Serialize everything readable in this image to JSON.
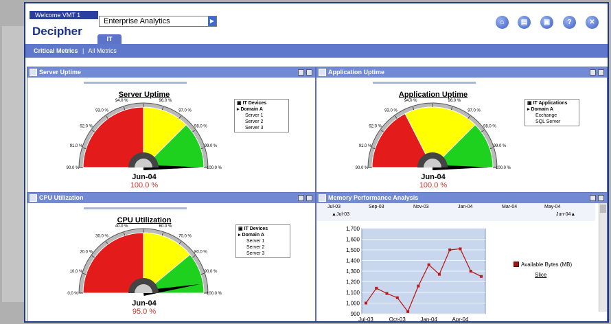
{
  "header": {
    "welcome": "Welcome VMT 1",
    "brand": "Decipher",
    "selector_value": "Enterprise Analytics",
    "tab_label": "IT"
  },
  "toolbar": {
    "icons": [
      "home-icon",
      "reports-icon",
      "print-icon",
      "help-icon",
      "close-icon"
    ],
    "help_glyph": "?",
    "close_glyph": "✕"
  },
  "nav": {
    "critical": "Critical Metrics",
    "separator": "|",
    "all": "All Metrics"
  },
  "panels": {
    "server": {
      "header": "Server Uptime",
      "title": "Server Uptime",
      "date": "Jun-04",
      "value": "100.0 %",
      "value_pct": 100,
      "labels": [
        "90.0 %",
        "91.0 %",
        "92.0 %",
        "93.0 %",
        "94.0 %",
        "95.0 %",
        "96.0 %",
        "97.0 %",
        "98.0 %",
        "99.0 %",
        "100.0 %"
      ],
      "tree": {
        "head": "IT Devices",
        "selected": "Domain A",
        "items": [
          "Server 1",
          "Server 2",
          "Server 3"
        ]
      }
    },
    "app": {
      "header": "Application Uptime",
      "title": "Application Uptime",
      "date": "Jun-04",
      "value": "100.0 %",
      "value_pct": 100,
      "labels": [
        "90.0 %",
        "91.0 %",
        "92.0 %",
        "93.0 %",
        "94.0 %",
        "95.0 %",
        "96.0 %",
        "97.0 %",
        "98.0 %",
        "99.0 %",
        "100.0 %"
      ],
      "tree": {
        "head": "IT Applications",
        "selected": "Domain A",
        "items": [
          "Exchange",
          "SQL Server"
        ]
      }
    },
    "cpu": {
      "header": "CPU Utilization",
      "title": "CPU Utilization",
      "date": "Jun-04",
      "value": "95.0 %",
      "value_pct": 95,
      "labels": [
        "0.0 %",
        "10.0 %",
        "20.0 %",
        "30.0 %",
        "40.0 %",
        "50.0 %",
        "60.0 %",
        "70.0 %",
        "80.0 %",
        "90.0 %",
        "100.0 %"
      ],
      "tree": {
        "head": "IT Devices",
        "selected": "Domain A",
        "items": [
          "Server 1",
          "Server 2",
          "Server 3"
        ]
      }
    },
    "memory": {
      "header": "Memory Performance Analysis",
      "range_start": "Jul-03",
      "range_end": "Jun-04",
      "timeline_ticks": [
        "Jul-03",
        "Sep-03",
        "Nov-03",
        "Jan-04",
        "Mar-04",
        "May-04"
      ],
      "legend": "Available Bytes (MB)",
      "slice_link": "Slice"
    }
  },
  "chart_data": {
    "type": "line",
    "x": [
      "Jul-03",
      "Aug-03",
      "Sep-03",
      "Oct-03",
      "Nov-03",
      "Dec-03",
      "Jan-04",
      "Feb-04",
      "Mar-04",
      "Apr-04",
      "May-04",
      "Jun-04"
    ],
    "x_tick_labels": [
      "Jul-03",
      "Oct-03",
      "Jan-04",
      "Apr-04"
    ],
    "series": [
      {
        "name": "Available Bytes (MB)",
        "values": [
          1000,
          1140,
          1090,
          1050,
          920,
          1160,
          1360,
          1270,
          1500,
          1510,
          1300,
          1250
        ]
      }
    ],
    "y_tick_labels": [
      "900",
      "1,000",
      "1,100",
      "1,200",
      "1,300",
      "1,400",
      "1,500",
      "1,600",
      "1,700"
    ],
    "ylim": [
      900,
      1700
    ],
    "grid": true,
    "legend_position": "right",
    "colors": {
      "line": "#b81d1d",
      "plot_bg": "#c8d7ee",
      "grid": "#ffffff"
    }
  },
  "colors": {
    "brand": "#1a2f88",
    "nav": "#6078cc",
    "panel_header": "#7289d4",
    "gauge_red": "#e31b1b",
    "gauge_yellow": "#ffff00",
    "gauge_green": "#1fd11f"
  }
}
